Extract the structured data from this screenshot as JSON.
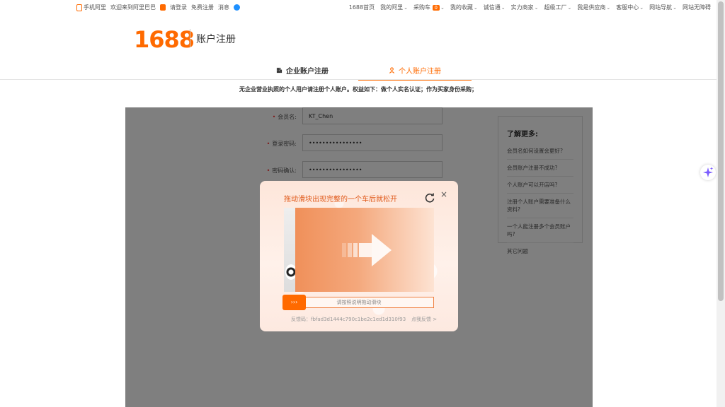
{
  "topbar": {
    "mobile": "手机阿里",
    "welcome": "欢迎来到阿里巴巴",
    "login": "请登录",
    "register": "免费注册",
    "messages": "消息",
    "home": "1688首页",
    "my_ali": "我的阿里",
    "cart": "采购车",
    "cart_count": "0",
    "favorites": "我的收藏",
    "chengxin": "诚信通",
    "merchants": "实力商家",
    "factory": "超级工厂",
    "supplier": "我是供应商",
    "service": "客服中心",
    "sitemap": "网站导航",
    "accessible": "网站无障碍"
  },
  "header": {
    "logo": "1688",
    "title": "账户注册"
  },
  "tabs": [
    {
      "label": "企业账户注册"
    },
    {
      "label": "个人账户注册"
    }
  ],
  "notice": "无企业营业执照的个人用户请注册个人账户。权益如下：做个人实名认证；作为买家身份采购；",
  "form": {
    "username_label": "会员名:",
    "username_value": "KT_Chen",
    "password_label": "登录密码:",
    "password_value": "••••••••••••••••",
    "confirm_label": "密码确认:",
    "confirm_value": "••••••••••••••••"
  },
  "side": {
    "title": "了解更多:",
    "links": [
      "会员名如何设置会更好?",
      "会员账户注册不成功?",
      "个人账户可以开店吗?",
      "注册个人账户需要准备什么资料?",
      "一个人能注册多个会员账户吗?",
      "其它问题"
    ]
  },
  "captcha": {
    "title": "拖动滑块出现完整的一个车后就松开",
    "slider_hint": "请按照说明拖动滑块",
    "knob": "›››",
    "feedback_code": "反馈码：fbfad3d1444c790c1be2c1ed1d310f93",
    "feedback_link": "点我反馈 >",
    "close": "×"
  },
  "colors": {
    "brand": "#ff6a00",
    "overlay": "rgba(0,0,0,0.5)"
  }
}
